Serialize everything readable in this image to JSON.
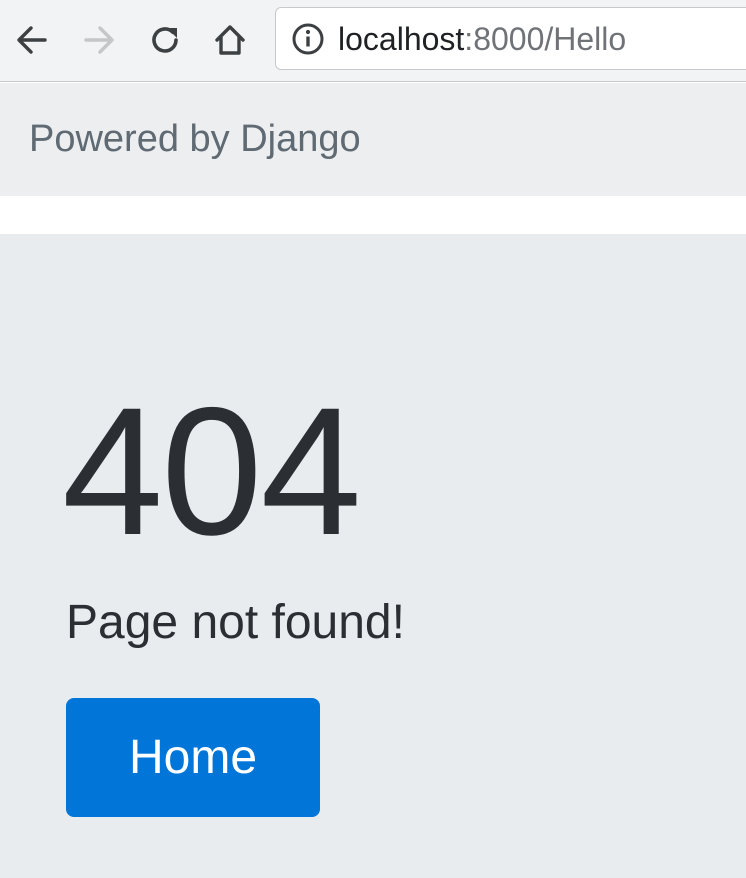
{
  "browser": {
    "url_host": "localhost",
    "url_path": ":8000/Hello",
    "icons": {
      "back": "arrow-left-icon",
      "forward": "arrow-right-icon",
      "reload": "reload-icon",
      "home": "home-icon",
      "info": "info-icon"
    },
    "forward_disabled": true
  },
  "navbar": {
    "brand": "Powered by Django"
  },
  "main": {
    "error_code": "404",
    "message": "Page not found!",
    "home_button_label": "Home"
  },
  "colors": {
    "primary_button": "#0275d8",
    "page_background": "#e9ecef",
    "navbar_background": "#eceef0",
    "brand_text": "#5f6a73",
    "heading_text": "#2b2f33"
  }
}
